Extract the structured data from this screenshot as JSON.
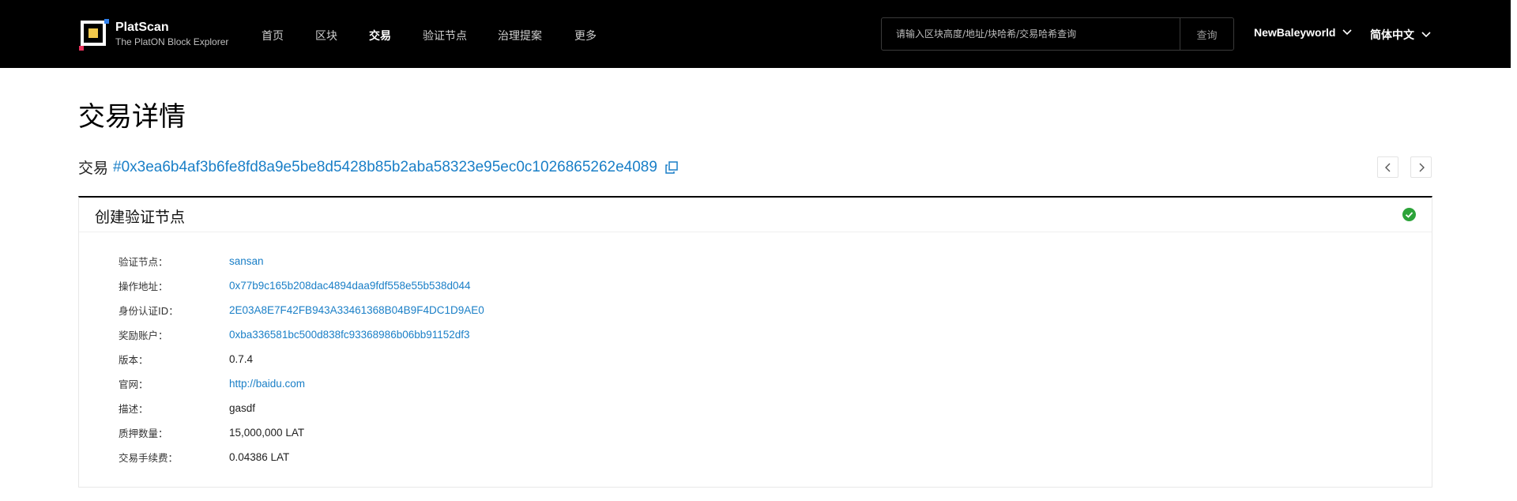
{
  "header": {
    "brand_title": "PlatScan",
    "brand_subtitle": "The PlatON Block Explorer",
    "nav": [
      {
        "label": "首页",
        "active": false
      },
      {
        "label": "区块",
        "active": false
      },
      {
        "label": "交易",
        "active": true
      },
      {
        "label": "验证节点",
        "active": false
      },
      {
        "label": "治理提案",
        "active": false
      },
      {
        "label": "更多",
        "active": false
      }
    ],
    "search_placeholder": "请输入区块高度/地址/块哈希/交易哈希查询",
    "search_button": "查询",
    "network": "NewBaleyworld",
    "language": "简体中文"
  },
  "page": {
    "title": "交易详情",
    "tx_label": "交易",
    "tx_hash": "#0x3ea6b4af3b6fe8fd8a9e5be8d5428b85b2aba58323e95ec0c1026865262e4089"
  },
  "panel": {
    "title": "创建验证节点",
    "status": "success",
    "rows": [
      {
        "label": "验证节点：",
        "value": "sansan",
        "link": true
      },
      {
        "label": "操作地址：",
        "value": "0x77b9c165b208dac4894daa9fdf558e55b538d044",
        "link": true
      },
      {
        "label": "身份认证ID：",
        "value": "2E03A8E7F42FB943A33461368B04B9F4DC1D9AE0",
        "link": true
      },
      {
        "label": "奖励账户：",
        "value": "0xba336581bc500d838fc93368986b06bb91152df3",
        "link": true
      },
      {
        "label": "版本：",
        "value": "0.7.4",
        "link": false
      },
      {
        "label": "官网：",
        "value": "http://baidu.com",
        "link": true
      },
      {
        "label": "描述：",
        "value": "gasdf",
        "link": false
      },
      {
        "label": "质押数量：",
        "value": "15,000,000 LAT",
        "link": false
      },
      {
        "label": "交易手续费：",
        "value": "0.04386 LAT",
        "link": false
      }
    ]
  },
  "colors": {
    "header_bg": "#000000",
    "link": "#1a7fc7",
    "success": "#2ca339",
    "logo_accent": "#f2c94c",
    "logo_red": "#e8315b",
    "logo_blue": "#2f80ed"
  }
}
